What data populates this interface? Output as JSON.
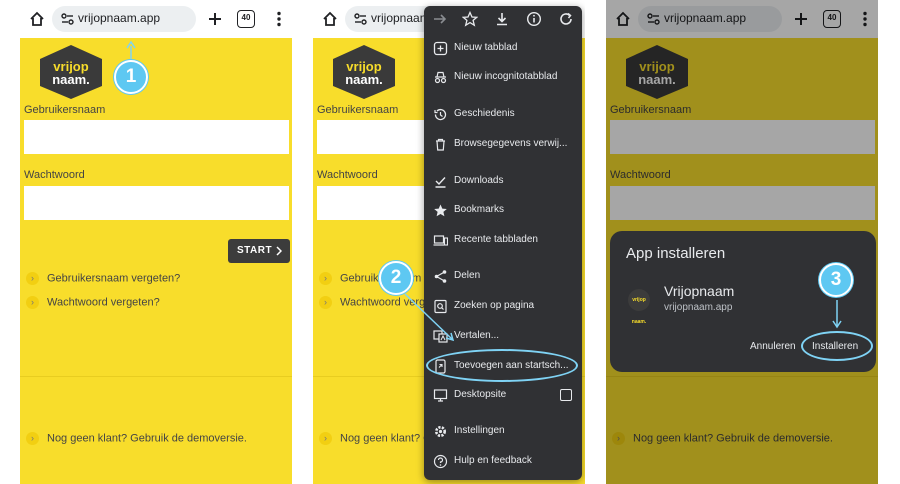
{
  "browser": {
    "url": "vrijopnaam.app",
    "tab_count": "40"
  },
  "site": {
    "logo_line1": "vrijop",
    "logo_line2": "naam.",
    "username_label": "Gebruikersnaam",
    "password_label": "Wachtwoord",
    "start_button": "START",
    "forgot_username": "Gebruikersnaam vergeten?",
    "forgot_password": "Wachtwoord vergeten?",
    "demo_link": "Nog geen klant? Gebruik de demoversie.",
    "link_bullet": "›"
  },
  "site_partial": {
    "forgot_username": "Gebruikersnaam vergeten?",
    "forgot_password": "Wachtwoord verg",
    "demo_link": "Nog geen klant? G"
  },
  "steps": {
    "one": "1",
    "two": "2",
    "three": "3"
  },
  "menu": {
    "items": [
      {
        "label": "Nieuw tabblad",
        "icon": "new-tab-icon"
      },
      {
        "label": "Nieuw incognitotabblad",
        "icon": "incognito-icon"
      },
      {
        "label": "Geschiedenis",
        "icon": "history-icon"
      },
      {
        "label": "Browsegegevens verwij...",
        "icon": "trash-icon"
      },
      {
        "label": "Downloads",
        "icon": "download-check-icon"
      },
      {
        "label": "Bookmarks",
        "icon": "star-icon"
      },
      {
        "label": "Recente tabbladen",
        "icon": "devices-icon"
      },
      {
        "label": "Delen",
        "icon": "share-icon"
      },
      {
        "label": "Zoeken op pagina",
        "icon": "find-icon"
      },
      {
        "label": "Vertalen...",
        "icon": "translate-icon"
      },
      {
        "label": "Toevoegen aan startsch...",
        "icon": "add-to-home-icon"
      },
      {
        "label": "Desktopsite",
        "icon": "desktop-icon"
      },
      {
        "label": "Instellingen",
        "icon": "gear-icon"
      },
      {
        "label": "Hulp en feedback",
        "icon": "help-icon"
      }
    ]
  },
  "install_dialog": {
    "title": "App installeren",
    "app_name": "Vrijopnaam",
    "app_url": "vrijopnaam.app",
    "app_icon_text": "vrijop naam.",
    "cancel": "Annuleren",
    "install": "Installeren"
  },
  "colors": {
    "brand_yellow": "#f8dd2b",
    "highlight_blue": "#5ec8f2",
    "menu_bg": "#303134"
  }
}
